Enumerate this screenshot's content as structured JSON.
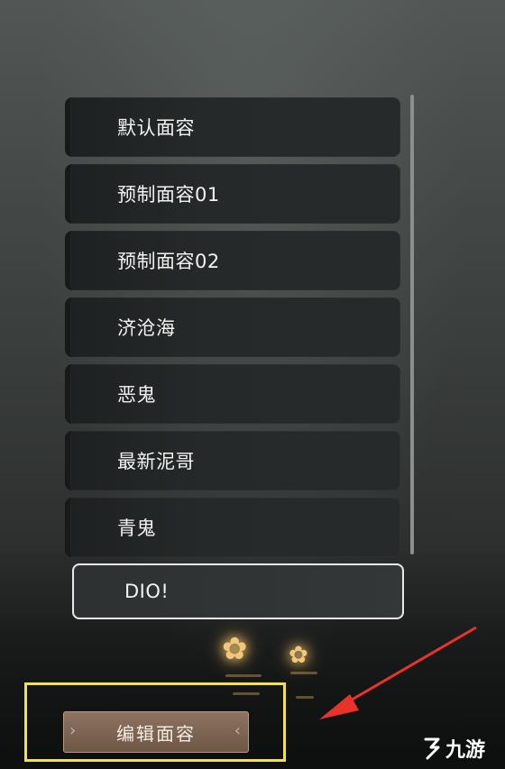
{
  "face_list": {
    "items": [
      {
        "label": "默认面容",
        "selected": false
      },
      {
        "label": "预制面容01",
        "selected": false
      },
      {
        "label": "预制面容02",
        "selected": false
      },
      {
        "label": "济沧海",
        "selected": false
      },
      {
        "label": "恶鬼",
        "selected": false
      },
      {
        "label": "最新泥哥",
        "selected": false
      },
      {
        "label": "青鬼",
        "selected": false
      },
      {
        "label": "DIO!",
        "selected": true
      }
    ]
  },
  "edit_button": {
    "label": "编辑面容"
  },
  "watermark": {
    "text": "九游"
  },
  "colors": {
    "highlight_box": "#f2e24a",
    "arrow": "#e8332a",
    "button_fill": "#7d6352",
    "selected_border": "#e8e8e8"
  }
}
